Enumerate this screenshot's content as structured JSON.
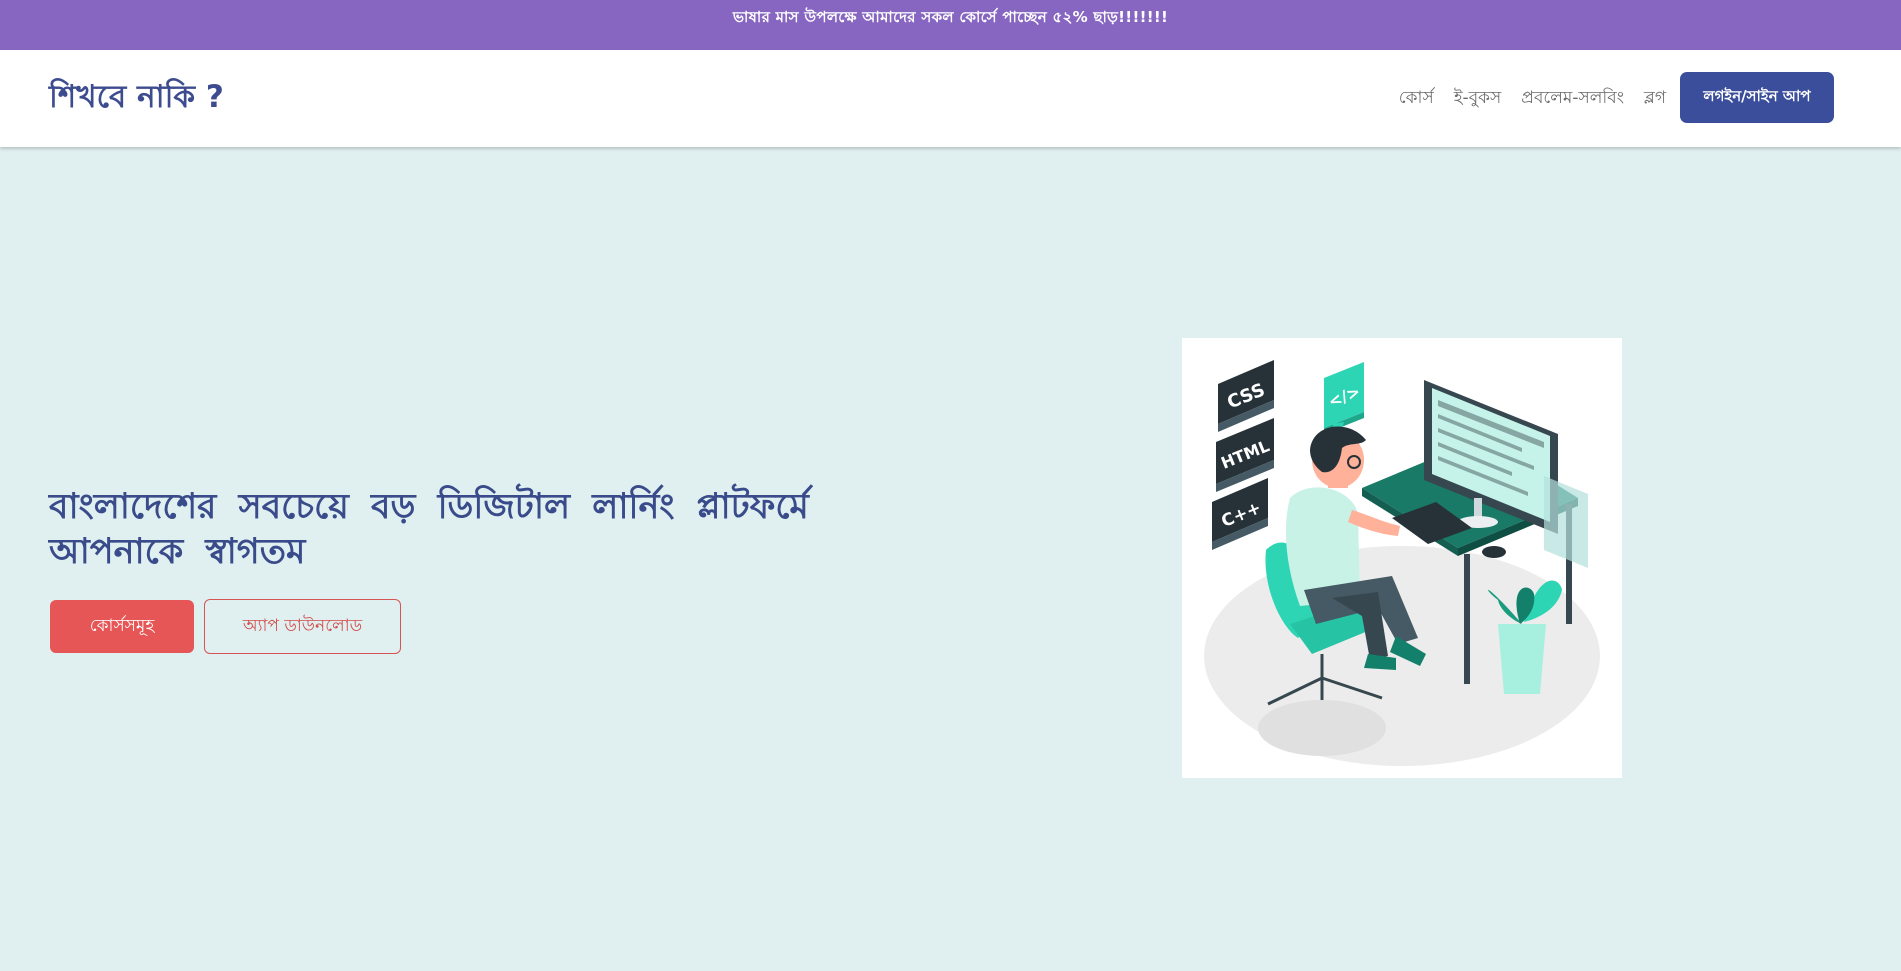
{
  "promo": {
    "text": "ভাষার মাস উপলক্ষে আমাদের সকল কোর্সে পাচ্ছেন ৫২% ছাড়!!!!!!!"
  },
  "nav": {
    "brand": "শিখবে নাকি ?",
    "links": [
      "কোর্স",
      "ই-বুকস",
      "প্রবলেম-সলবিং",
      "ব্লগ"
    ],
    "login_label": "লগইন/সাইন আপ"
  },
  "hero": {
    "title": "বাংলাদেশের সবচেয়ে বড় ডিজিটাল লার্নিং প্লাটফর্মে আপনাকে স্বাগতম",
    "courses_button": "কোর্সসমূহ",
    "app_button": "অ্যাপ ডাউনলোড"
  },
  "illustration": {
    "badges": [
      "CSS",
      "HTML",
      "C++",
      "</>"
    ]
  },
  "colors": {
    "promo_bg": "#8766c1",
    "brand": "#3d4c8e",
    "login_bg": "#3b4e9c",
    "hero_bg": "#e0f0f0",
    "primary_red": "#e65656",
    "illustration_teal": "#2ed5b4"
  }
}
